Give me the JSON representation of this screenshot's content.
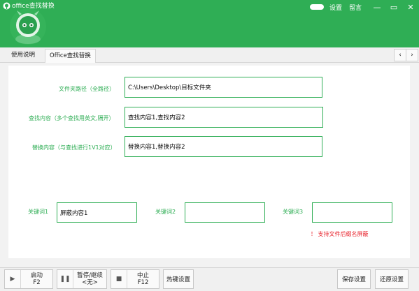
{
  "app": {
    "title": "office查找替换",
    "settings_label": "设置",
    "message_label": "留言"
  },
  "window": {
    "minimize": "—",
    "restore": "▭",
    "close": "✕"
  },
  "tabs": [
    {
      "label": "使用说明"
    },
    {
      "label": "Office查找替换"
    }
  ],
  "tab_nav": {
    "prev": "‹",
    "next": "›"
  },
  "form": {
    "folder_label": "文件夹路径（全路径）",
    "folder_value": "C:\\Users\\Desktop\\目标文件夹",
    "find_label": "查找内容（多个查找用英文,隔开）",
    "find_value": "查找内容1,查找内容2",
    "replace_label": "替换内容（与查找进行1V1对应）",
    "replace_value": "替换内容1,替换内容2"
  },
  "keywords": [
    {
      "label": "关键词1",
      "value": "屏蔽内容1"
    },
    {
      "label": "关键词2",
      "value": ""
    },
    {
      "label": "关键词3",
      "value": ""
    }
  ],
  "warning": "！ 支持文件后缀名屏蔽",
  "toolbar": {
    "start_line1": "启动",
    "start_line2": "F2",
    "pause_line1": "暂停/继续",
    "pause_line2": "<无>",
    "stop_line1": "中止",
    "stop_line2": "F12",
    "hotkey_label": "热键设置",
    "save_label": "保存设置",
    "restore_label": "还原设置"
  },
  "colors": {
    "accent": "#2fae55",
    "warning": "#e8202a"
  }
}
